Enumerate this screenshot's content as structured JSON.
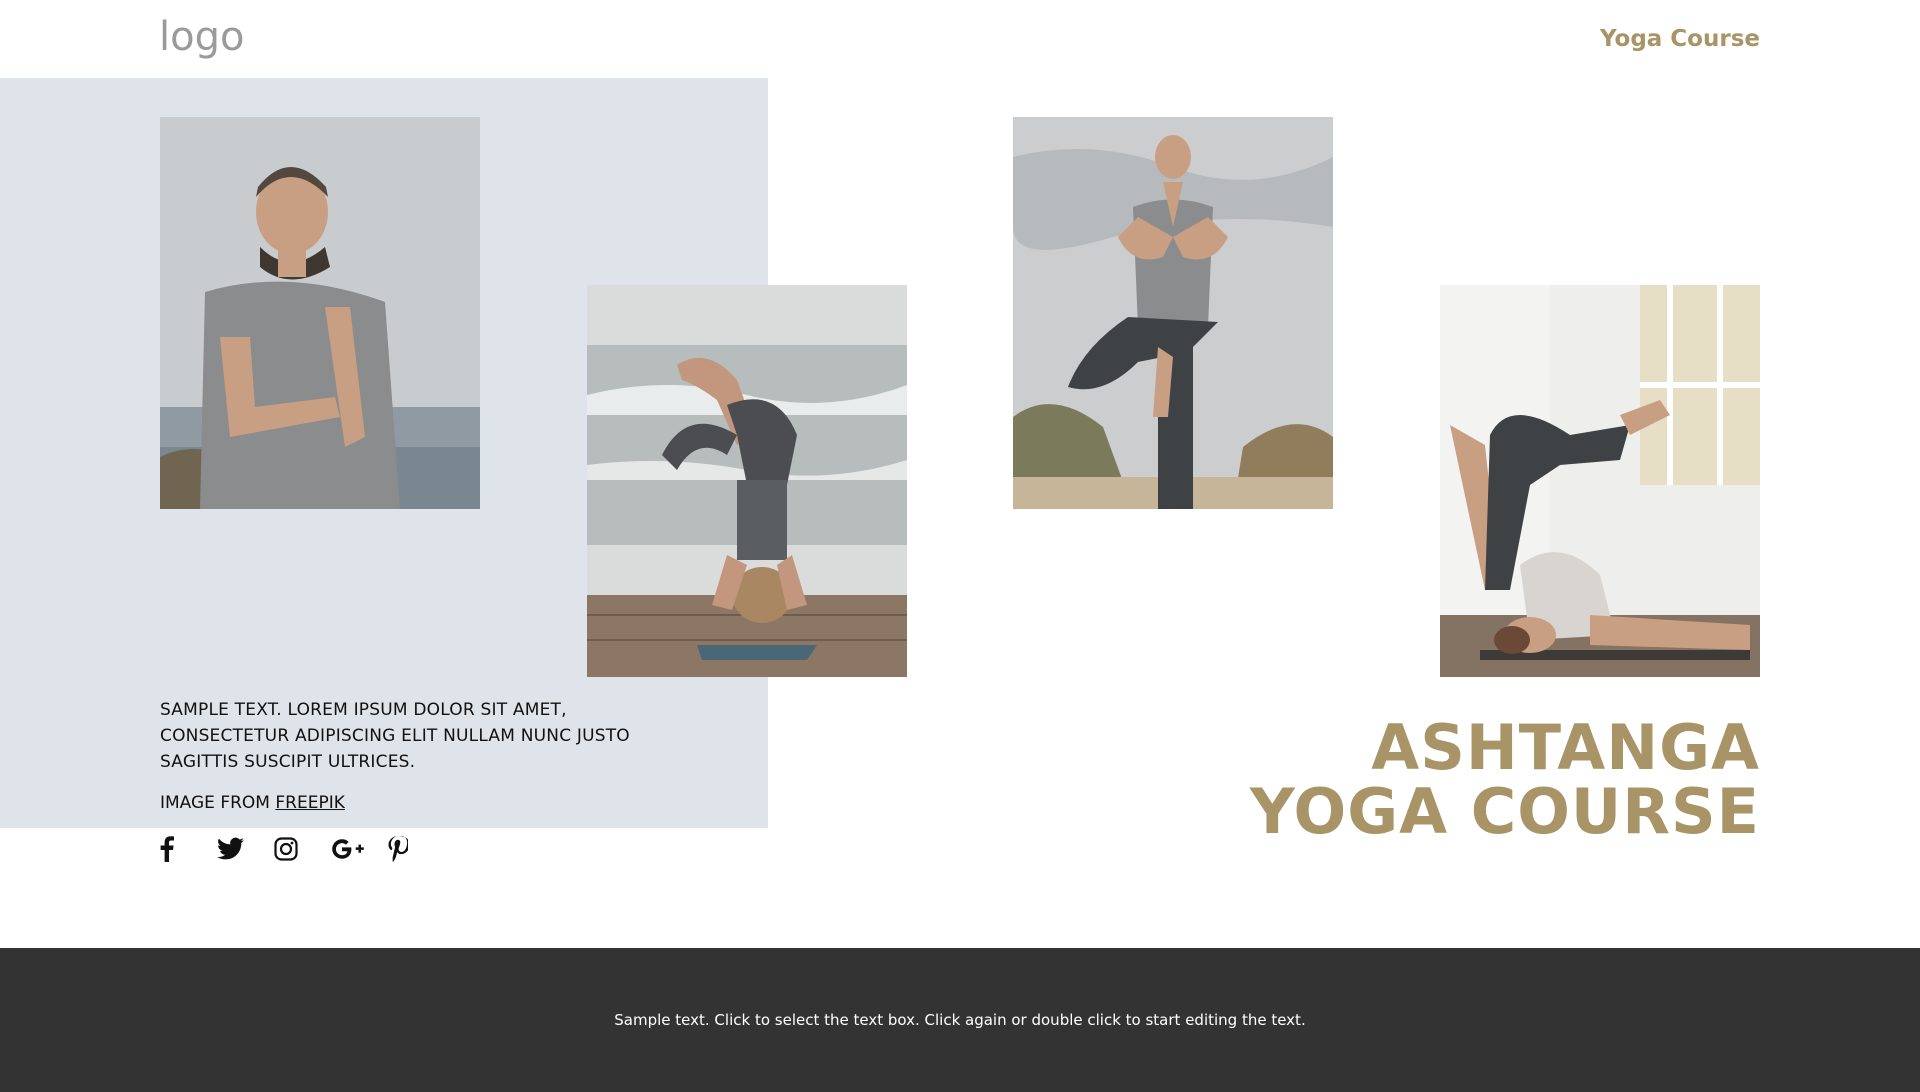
{
  "header": {
    "logo_text": "logo",
    "nav_link": "Yoga Course"
  },
  "main": {
    "sample_text": "Sample text. Lorem ipsum dolor sit amet, consectetur adipiscing elit nullam nunc justo sagittis suscipit ultrices.",
    "credit_prefix": "Image from",
    "credit_link": "Freepik",
    "headline_line1": "Ashtanga",
    "headline_line2": "Yoga Course"
  },
  "social": [
    "facebook-icon",
    "twitter-icon",
    "instagram-icon",
    "google-plus-icon",
    "pinterest-icon"
  ],
  "footer": {
    "text": "Sample text. Click to select the text box. Click again or double click to start editing the text."
  },
  "colors": {
    "accent": "#a89466",
    "panel": "#dfe3ea",
    "footer_bg": "#333333"
  }
}
